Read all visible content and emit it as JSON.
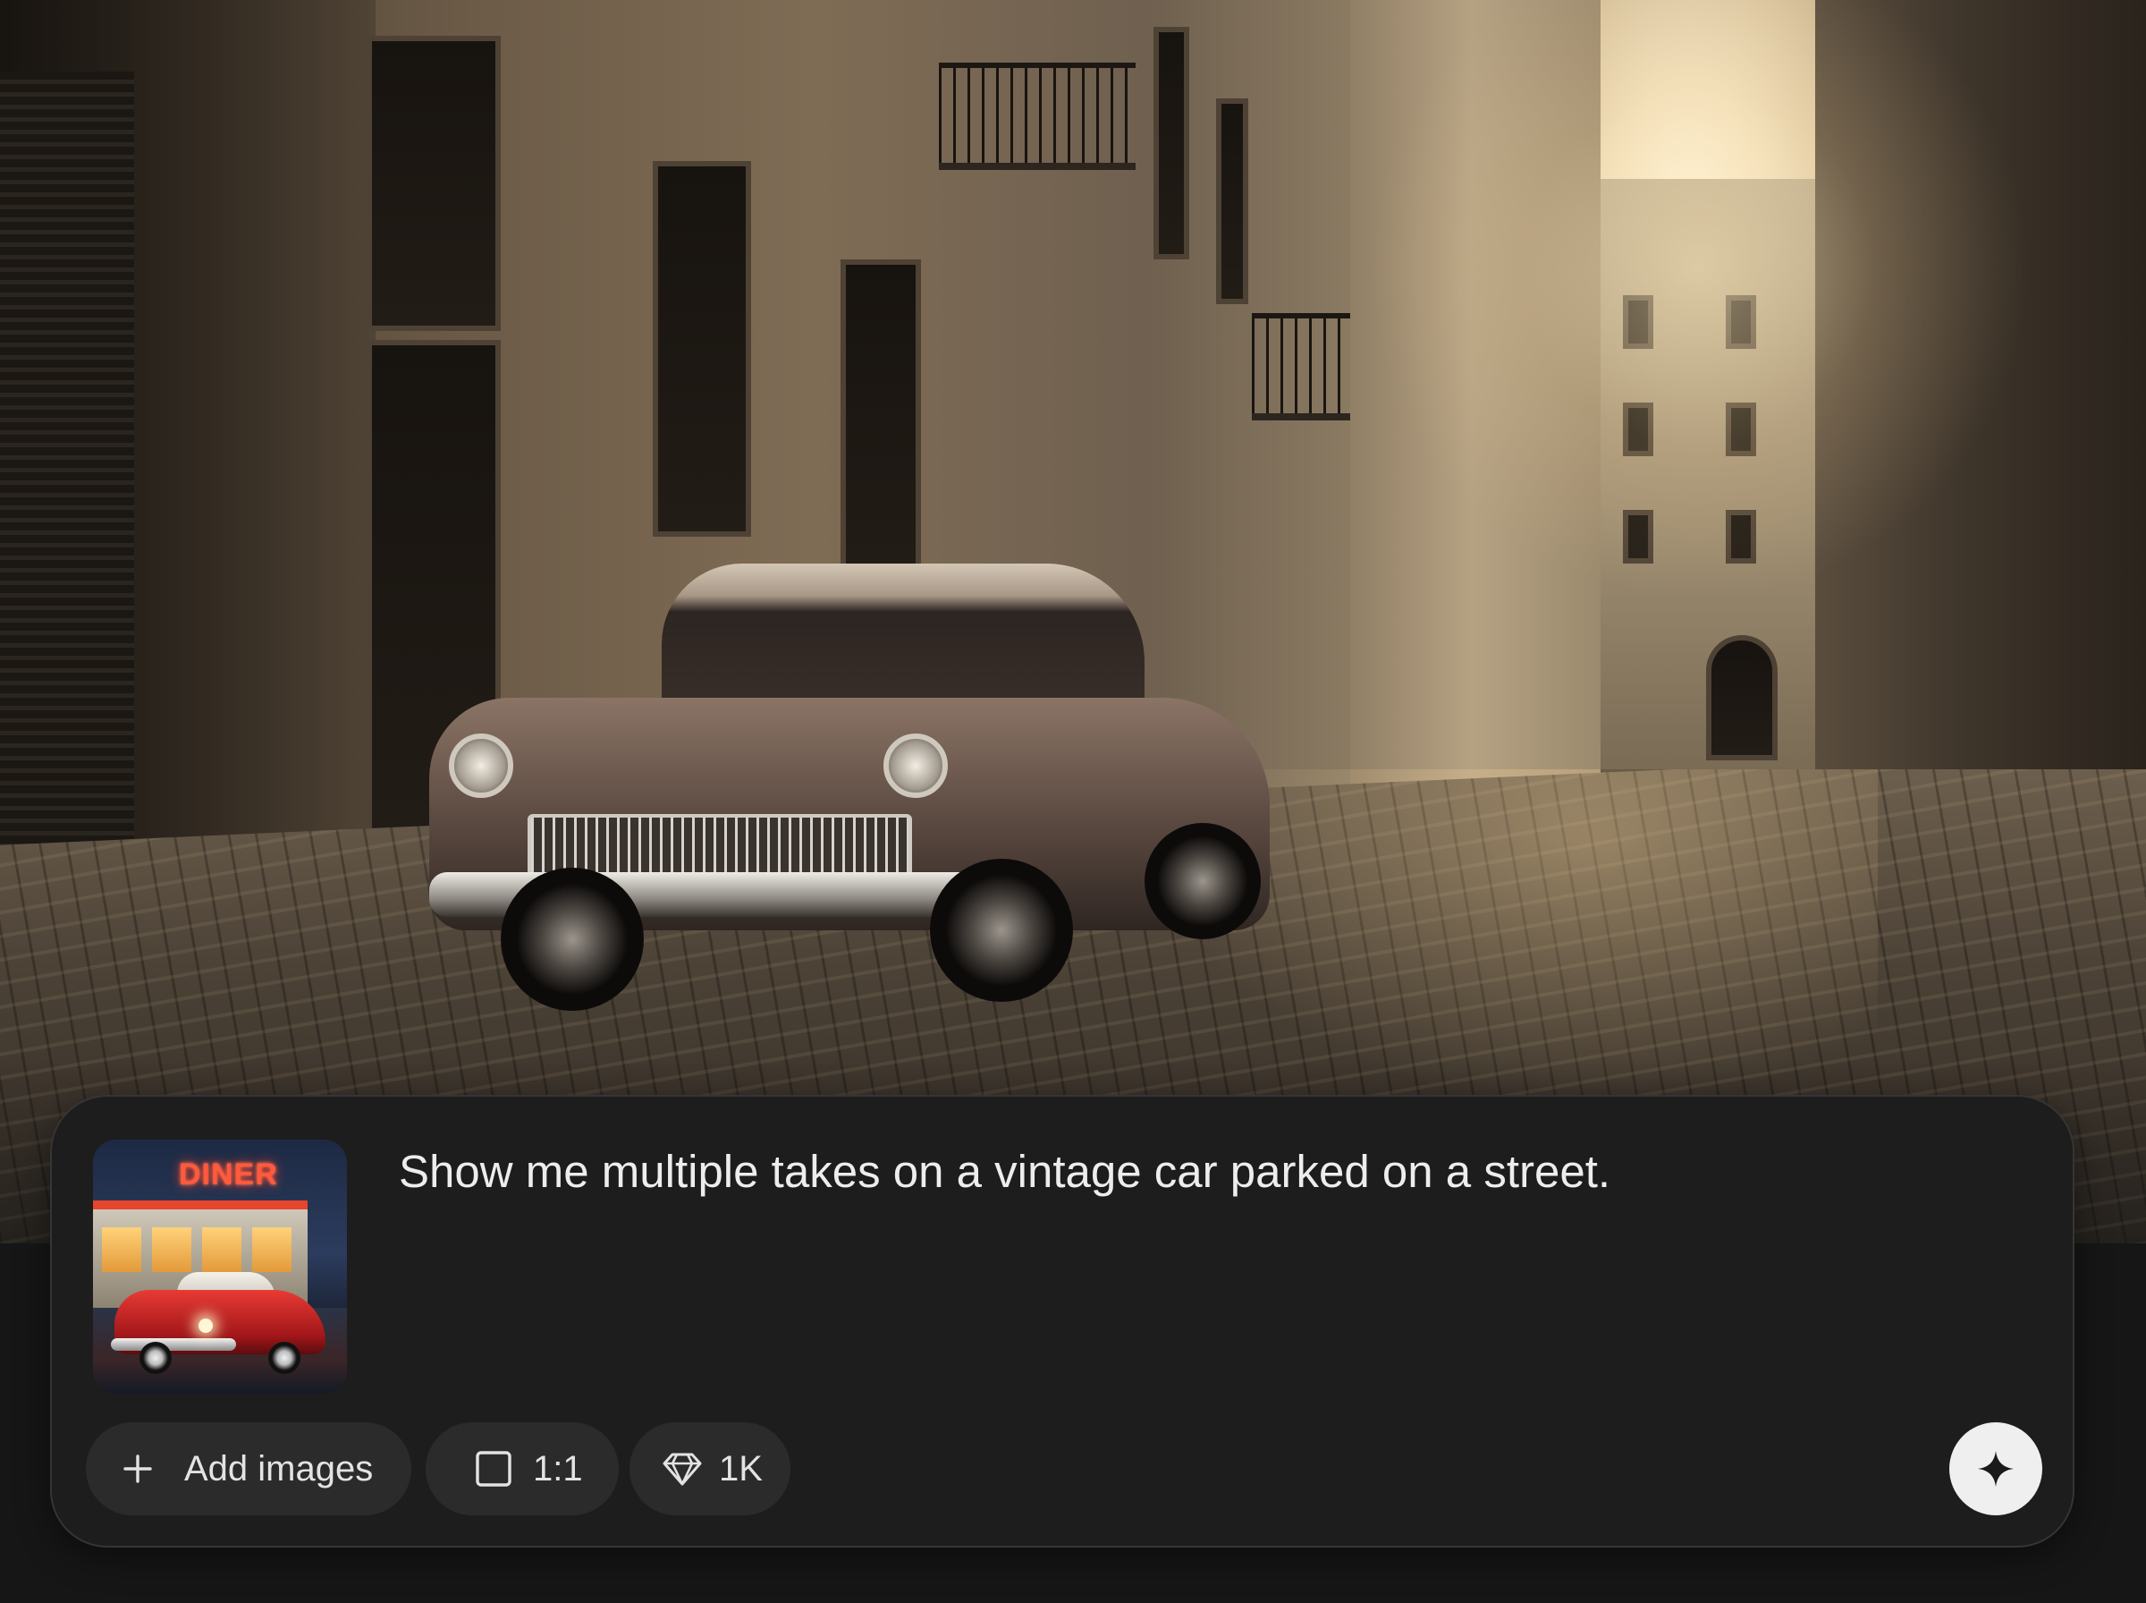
{
  "prompt": {
    "text": "Show me multiple takes on a vintage car parked on a street."
  },
  "reference_image": {
    "sign_text": "DINER"
  },
  "toolbar": {
    "add_images_label": "Add images",
    "aspect_ratio_label": "1:1",
    "resolution_label": "1K"
  },
  "icons": {
    "add": "plus-icon",
    "aspect_ratio": "square-icon",
    "resolution": "diamond-icon",
    "generate": "sparkle-icon"
  },
  "colors": {
    "panel": "#1d1d1d",
    "chip": "#2b2b2b",
    "text": "#ededed",
    "generate_button": "#efefef"
  }
}
